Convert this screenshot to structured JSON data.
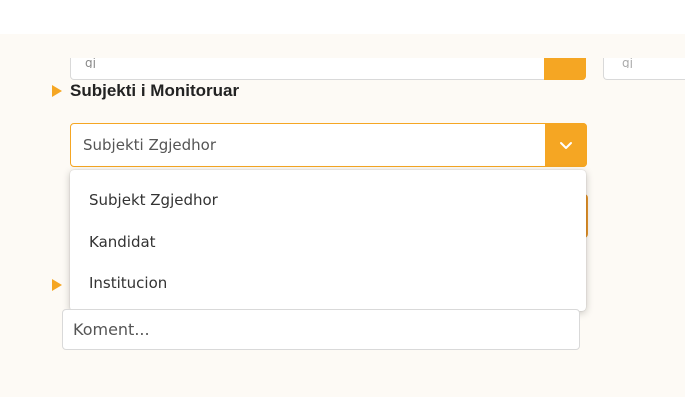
{
  "header": {
    "clipped_value": "gj",
    "side_clipped_value": "gj"
  },
  "section": {
    "title": "Subjekti i Monitoruar"
  },
  "select": {
    "value": "Subjekti Zgjedhor",
    "chevron_icon": "chevron-down-icon"
  },
  "dropdown": {
    "options": [
      {
        "label": "Subjekt Zgjedhor"
      },
      {
        "label": "Kandidat"
      },
      {
        "label": "Institucion"
      }
    ]
  },
  "comment": {
    "placeholder": "Koment..."
  },
  "colors": {
    "accent": "#f5a623",
    "background": "#fdfaf5"
  }
}
